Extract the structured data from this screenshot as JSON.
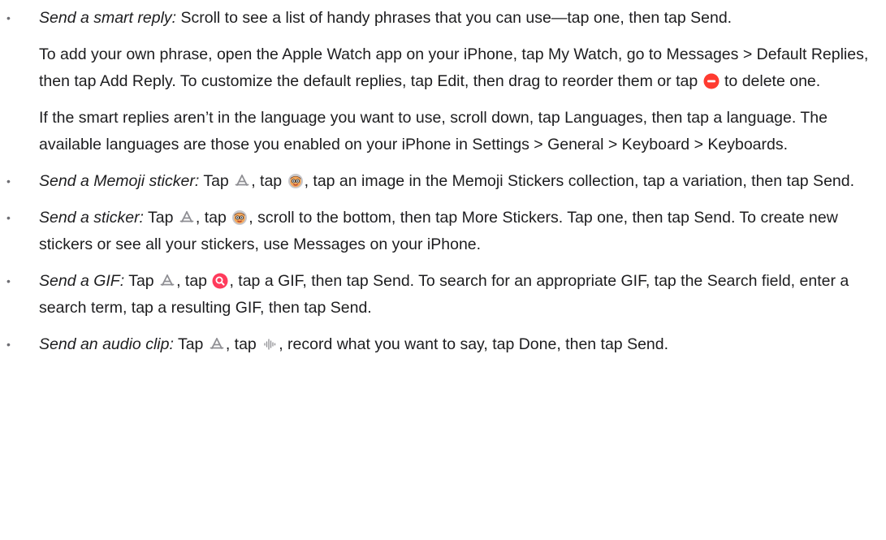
{
  "items": [
    {
      "title": "Send a smart reply:",
      "text": " Scroll to see a list of handy phrases that you can use—tap one, then tap Send.",
      "para2_a": "To add your own phrase, open the Apple Watch app on your iPhone, tap My Watch, go to Messages > Default Replies, then tap Add Reply. To customize the default replies, tap Edit, then drag to reorder them or tap ",
      "para2_b": " to delete one.",
      "para3": "If the smart replies aren’t in the language you want to use, scroll down, tap Languages, then tap a language. The available languages are those you enabled on your iPhone in Settings > General > Keyboard > Keyboards."
    },
    {
      "title": "Send a Memoji sticker:",
      "a": " Tap ",
      "b": ", tap ",
      "c": ", tap an image in the Memoji Stickers collection, tap a variation, then tap Send."
    },
    {
      "title": "Send a sticker:",
      "a": " Tap ",
      "b": ", tap ",
      "c": ", scroll to the bottom, then tap More Stickers. Tap one, then tap Send. To create new stickers or see all your stickers, use Messages on your iPhone."
    },
    {
      "title": "Send a GIF:",
      "a": " Tap ",
      "b": ", tap ",
      "c": ", tap a GIF, then tap Send. To search for an appropriate GIF, tap the Search field, enter a search term, tap a resulting GIF, then tap Send."
    },
    {
      "title": "Send an audio clip:",
      "a": " Tap ",
      "b": ", tap ",
      "c": ", record what you want to say, tap Done, then tap Send."
    }
  ],
  "bullet": "•",
  "icons": {
    "delete": "delete-minus-icon",
    "apps": "app-store-icon",
    "memoji": "memoji-icon",
    "gif": "gif-search-icon",
    "audio": "audio-waveform-icon"
  },
  "colors": {
    "text": "#1d1d1f",
    "delete_red": "#ff3b30",
    "icon_gray": "#8e8e93",
    "gif_red": "#ff3b5c"
  }
}
